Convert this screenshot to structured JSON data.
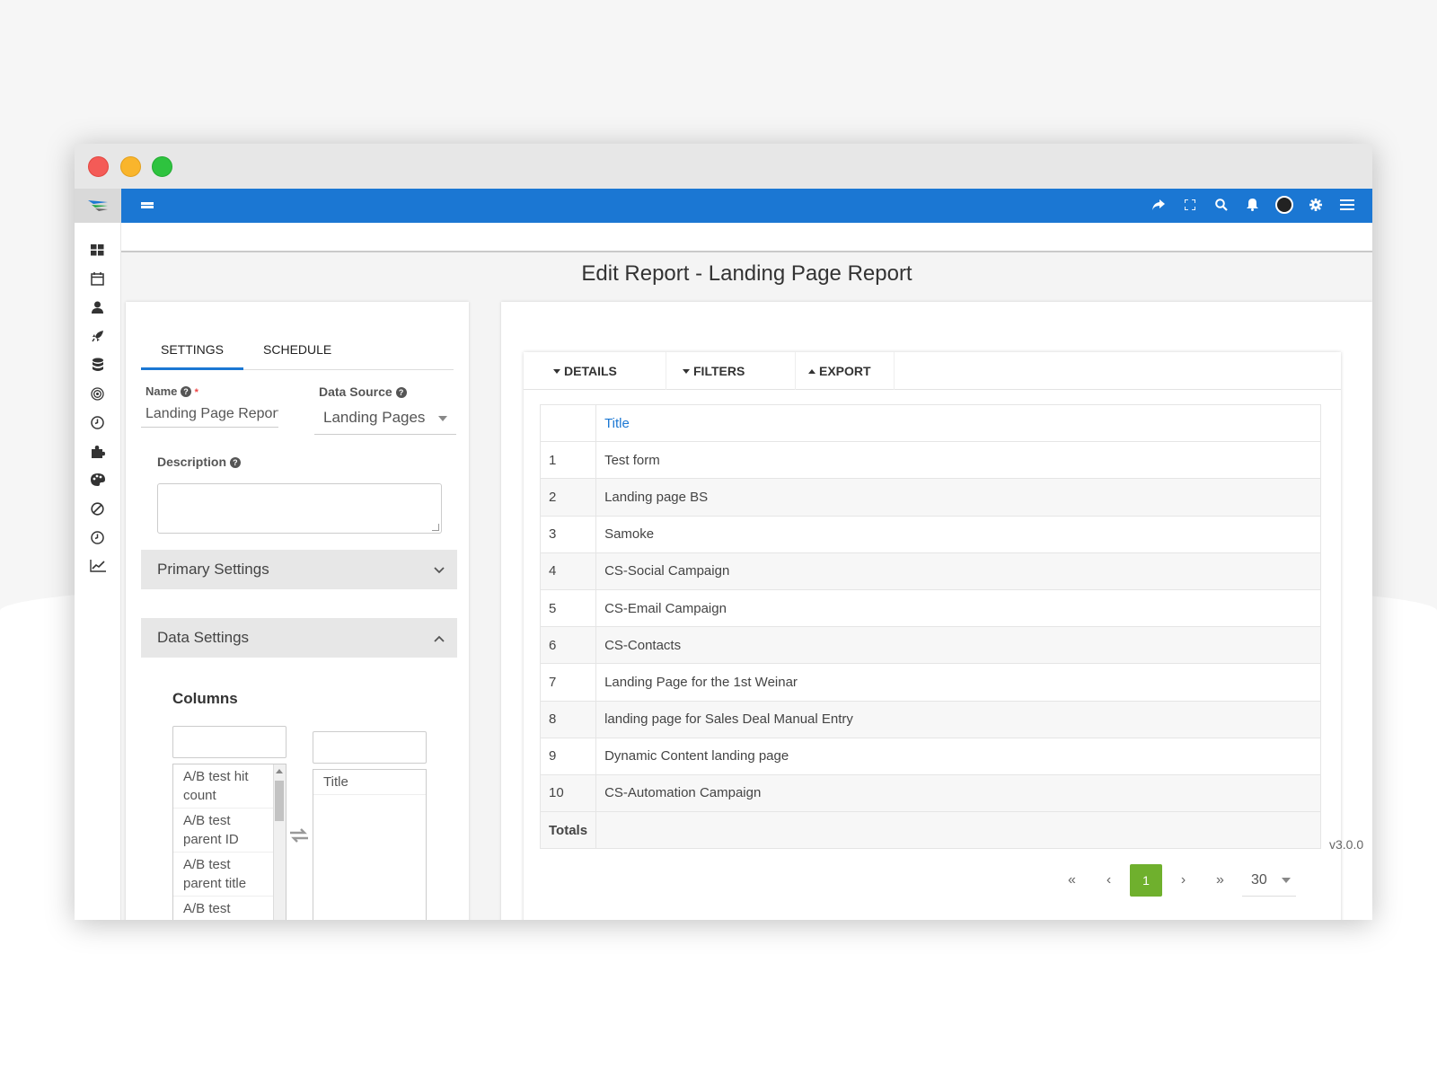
{
  "topbar": {
    "menu_icon": "bars-icon",
    "icons": [
      "share-icon",
      "fullscreen-icon",
      "search-icon",
      "bell-icon",
      "avatar",
      "gear-icon",
      "hamburger-icon"
    ],
    "accent": "#1b77d3"
  },
  "sidebar": {
    "icons": [
      "dashboard-icon",
      "calendar-icon",
      "user-icon",
      "rocket-icon",
      "database-icon",
      "target-icon",
      "clock-icon",
      "puzzle-icon",
      "palette-icon",
      "block-icon",
      "clock-icon",
      "chart-line-icon"
    ]
  },
  "page": {
    "title": "Edit Report - Landing Page Report"
  },
  "settings": {
    "tabs": {
      "settings": "SETTINGS",
      "schedule": "SCHEDULE"
    },
    "name_label": "Name",
    "name_value": "Landing Page Report",
    "datasource_label": "Data Source",
    "datasource_value": "Landing Pages",
    "description_label": "Description",
    "description_value": "",
    "primary_settings": "Primary Settings",
    "data_settings": "Data Settings",
    "columns_title": "Columns",
    "available_columns": [
      "A/B test hit count",
      "A/B test parent ID",
      "A/B test parent title",
      "A/B test"
    ],
    "selected_columns": [
      "Title"
    ]
  },
  "report": {
    "tabs": {
      "details": "DETAILS",
      "filters": "FILTERS",
      "export": "EXPORT"
    },
    "header": {
      "num": "",
      "title": "Title"
    },
    "rows": [
      {
        "num": "1",
        "title": "Test form"
      },
      {
        "num": "2",
        "title": "Landing page BS"
      },
      {
        "num": "3",
        "title": "Samoke"
      },
      {
        "num": "4",
        "title": "CS-Social Campaign"
      },
      {
        "num": "5",
        "title": "CS-Email Campaign"
      },
      {
        "num": "6",
        "title": "CS-Contacts"
      },
      {
        "num": "7",
        "title": "Landing Page for the 1st Weinar"
      },
      {
        "num": "8",
        "title": "landing page for Sales Deal Manual Entry"
      },
      {
        "num": "9",
        "title": "Dynamic Content landing page"
      },
      {
        "num": "10",
        "title": "CS-Automation Campaign"
      }
    ],
    "totals_label": "Totals",
    "pager": {
      "first": "«",
      "prev": "‹",
      "current": "1",
      "next": "›",
      "last": "»"
    },
    "per_page": "30",
    "version": "v3.0.0"
  }
}
